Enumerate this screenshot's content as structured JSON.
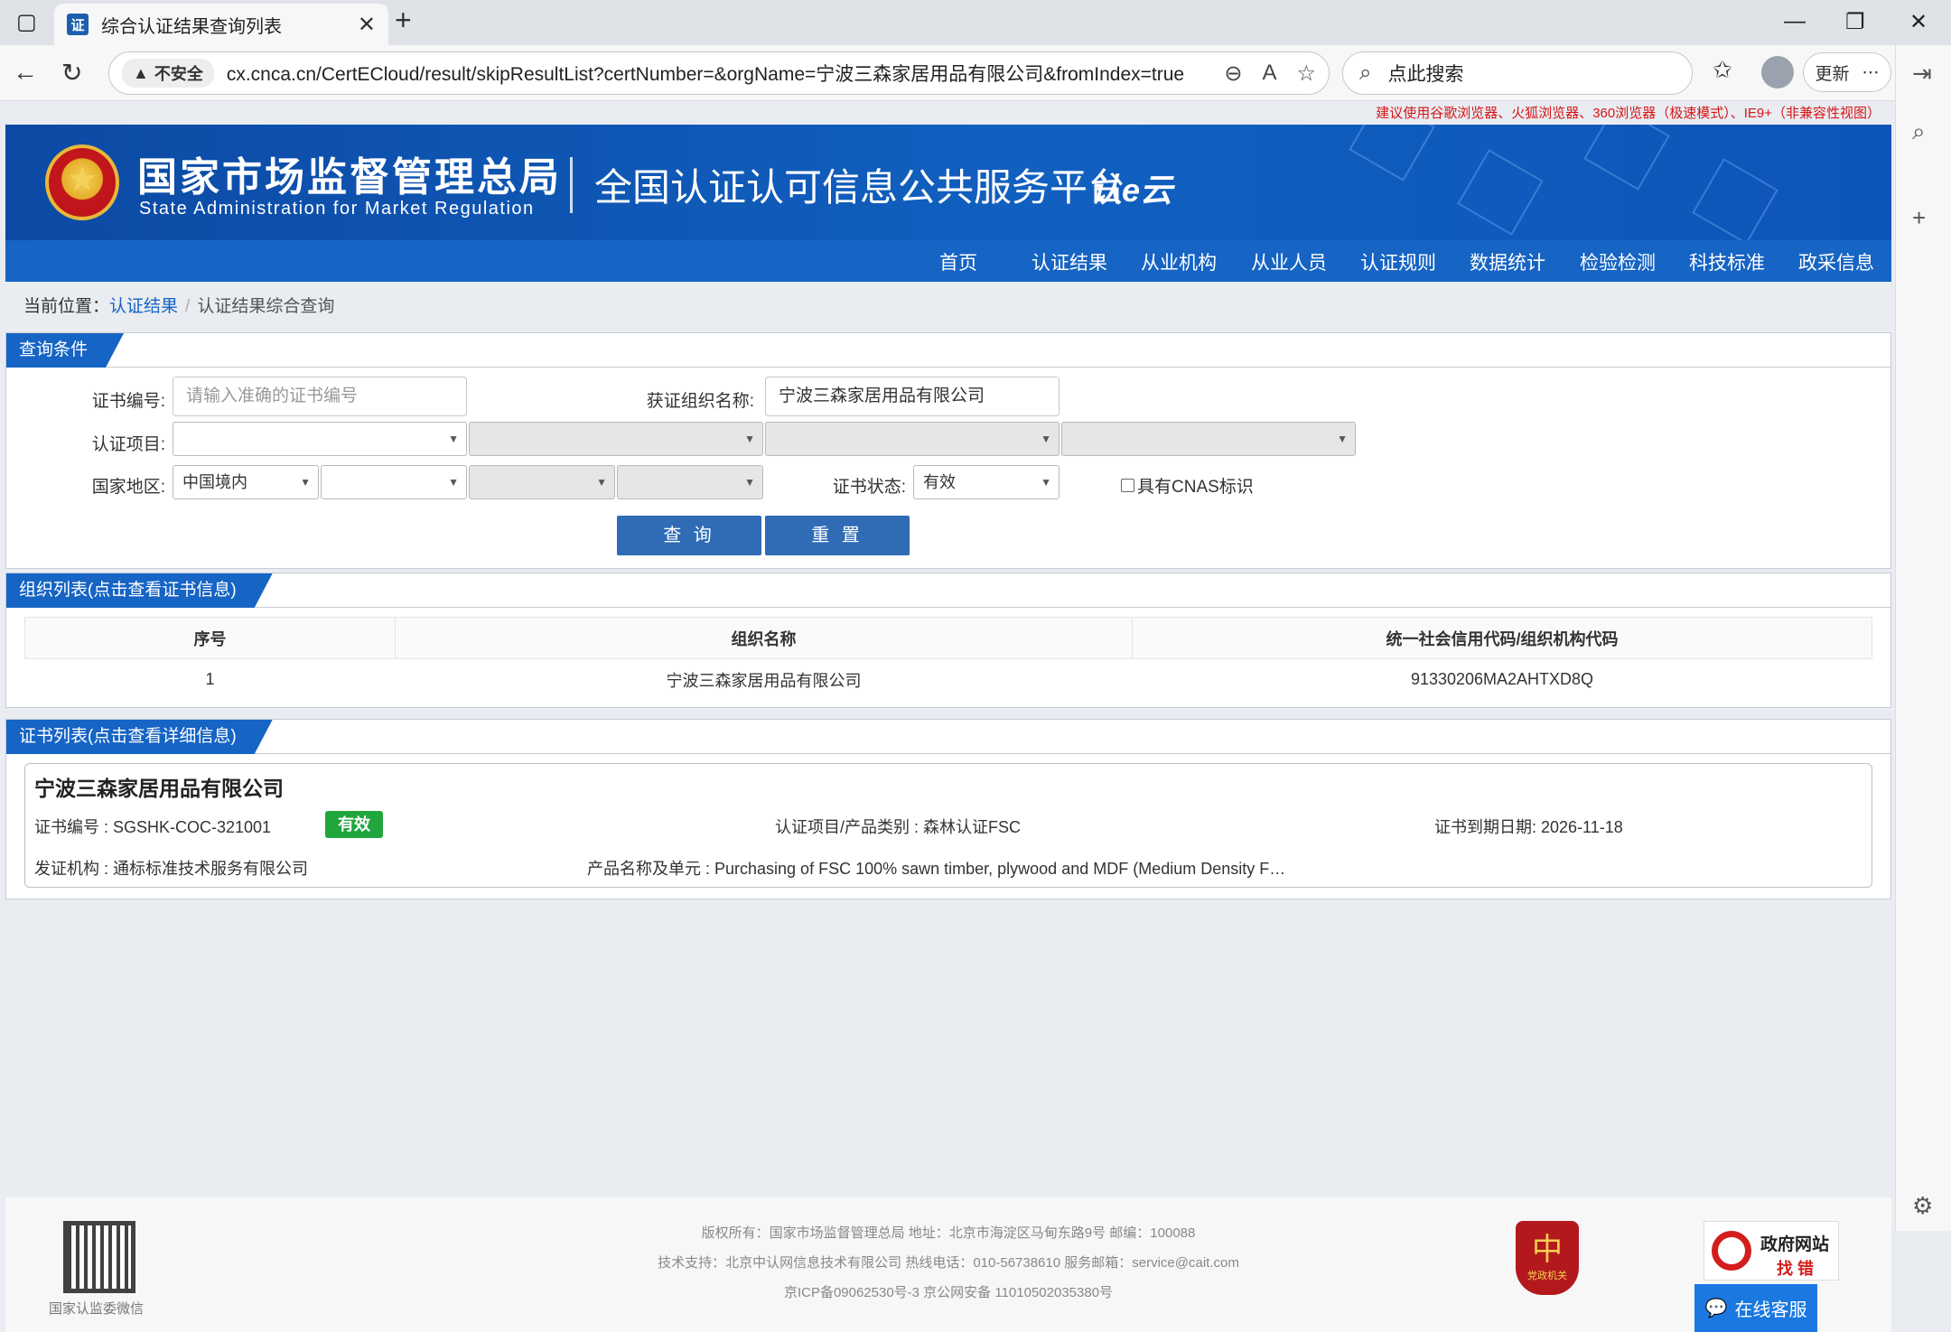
{
  "browser": {
    "tab_title": "综合认证结果查询列表",
    "tab_favicon": "证",
    "security_label": "不安全",
    "url": "cx.cnca.cn/CertECloud/result/skipResultList?certNumber=&orgName=宁波三森家居用品有限公司&fromIndex=true",
    "search_placeholder": "点此搜索",
    "update_label": "更新"
  },
  "notice": "建议使用谷歌浏览器、火狐浏览器、360浏览器（极速模式）、IE9+（非兼容性视图）",
  "header": {
    "org_cn": "国家市场监督管理总局",
    "org_en": "State Administration  for  Market Regulation",
    "platform": "全国认证认可信息公共服务平台",
    "cloud_logo": "认e云"
  },
  "nav": [
    "首页",
    "认证结果",
    "从业机构",
    "从业人员",
    "认证规则",
    "数据统计",
    "检验检测",
    "科技标准",
    "政采信息"
  ],
  "breadcrumb": {
    "prefix": "当前位置：",
    "link": "认证结果",
    "current": "认证结果综合查询"
  },
  "query": {
    "title": "查询条件",
    "cert_no_label": "证书编号:",
    "cert_no_placeholder": "请输入准确的证书编号",
    "org_name_label": "获证组织名称:",
    "org_name_value": "宁波三森家居用品有限公司",
    "project_label": "认证项目:",
    "region_label": "国家地区:",
    "region_value": "中国境内",
    "status_label": "证书状态:",
    "status_value": "有效",
    "cnas_label": "具有CNAS标识",
    "search_btn": "查 询",
    "reset_btn": "重 置"
  },
  "org_list": {
    "title": "组织列表(点击查看证书信息)",
    "columns": [
      "序号",
      "组织名称",
      "统一社会信用代码/组织机构代码"
    ],
    "rows": [
      [
        "1",
        "宁波三森家居用品有限公司",
        "91330206MA2AHTXD8Q"
      ]
    ]
  },
  "cert_list": {
    "title": "证书列表(点击查看详细信息)",
    "org": "宁波三森家居用品有限公司",
    "cert_no": "证书编号 : SGSHK-COC-321001",
    "status": "有效",
    "project": "认证项目/产品类别 : 森林认证FSC",
    "expiry": "证书到期日期: 2026-11-18",
    "issuer": "发证机构 : 通标标准技术服务有限公司",
    "product": "产品名称及单元 : Purchasing of FSC 100% sawn timber, plywood and MDF (Medium Density F…"
  },
  "footer": {
    "line1": "版权所有：国家市场监督管理总局    地址：北京市海淀区马甸东路9号    邮编：100088",
    "line2": "技术支持：北京中认网信息技术有限公司    热线电话：010-56738610    服务邮箱：service@cait.com",
    "line3": "京ICP备09062530号-3     京公网安备  11010502035380号",
    "qr_caption": "国家认监委微信",
    "party_caption": "党政机关",
    "gov_line1": "政府网站",
    "gov_line2": "找 错",
    "kefu": "在线客服"
  },
  "colors": {
    "brand_blue": "#1664c4",
    "status_green": "#21a63e",
    "notice_red": "#d41616"
  }
}
